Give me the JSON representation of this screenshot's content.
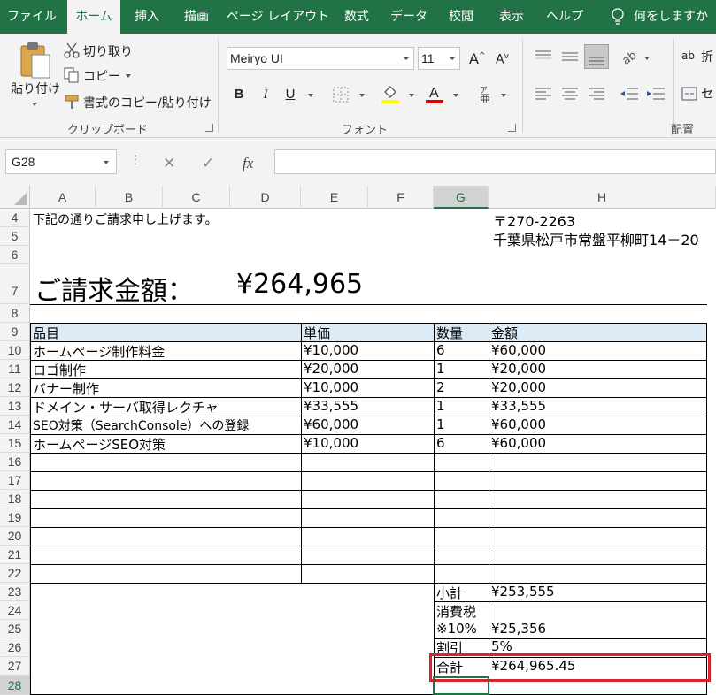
{
  "menu": {
    "tabs": [
      "ファイル",
      "ホーム",
      "挿入",
      "描画",
      "ページ レイアウト",
      "数式",
      "データ",
      "校閲",
      "表示",
      "ヘルプ"
    ],
    "tell_me": "何をしますか"
  },
  "ribbon": {
    "clipboard": {
      "paste": "貼り付け",
      "cut": "切り取り",
      "copy": "コピー",
      "format_painter": "書式のコピー/貼り付け",
      "label": "クリップボード"
    },
    "font": {
      "font_name": "Meiryo UI",
      "font_size": "11",
      "bold": "B",
      "italic": "I",
      "underline": "U",
      "label": "フォント"
    },
    "alignment": {
      "wrap": "折",
      "merge": "セ",
      "label": "配置"
    }
  },
  "formula_bar": {
    "name_box": "G28",
    "fx": "fx",
    "formula": ""
  },
  "sheet": {
    "columns": [
      "A",
      "B",
      "C",
      "D",
      "E",
      "F",
      "G",
      "H"
    ],
    "rows": [
      "4",
      "5",
      "6",
      "7",
      "8",
      "9",
      "10",
      "11",
      "12",
      "13",
      "14",
      "15",
      "16",
      "17",
      "18",
      "19",
      "20",
      "21",
      "22",
      "23",
      "24",
      "25",
      "26",
      "27",
      "28"
    ],
    "intro": "下記の通りご請求申し上げます。",
    "postal": "〒270-2263",
    "address": "千葉県松戸市常盤平柳町14－20",
    "total_label": "ご請求金額：",
    "total_value": "¥264,965",
    "table_header": [
      "品目",
      "単価",
      "数量",
      "金額"
    ],
    "items": [
      {
        "name": "ホームページ制作料金",
        "price": "¥10,000",
        "qty": "6",
        "amount": "¥60,000"
      },
      {
        "name": "ロゴ制作",
        "price": "¥20,000",
        "qty": "1",
        "amount": "¥20,000"
      },
      {
        "name": "バナー制作",
        "price": "¥10,000",
        "qty": "2",
        "amount": "¥20,000"
      },
      {
        "name": "ドメイン・サーバ取得レクチャ",
        "price": "¥33,555",
        "qty": "1",
        "amount": "¥33,555"
      },
      {
        "name": "SEO対策（SearchConsole）への登録",
        "price": "¥60,000",
        "qty": "1",
        "amount": "¥60,000"
      },
      {
        "name": "ホームページSEO対策",
        "price": "¥10,000",
        "qty": "6",
        "amount": "¥60,000"
      }
    ],
    "subtotal_label": "小計",
    "subtotal_value": "¥253,555",
    "tax_label_1": "消費税",
    "tax_label_2": "※10%",
    "tax_value": "¥25,356",
    "discount_label": "割引",
    "discount_value": "5%",
    "grand_label": "合計",
    "grand_value": "¥264,965.45"
  },
  "colors": {
    "excel_green": "#217346",
    "header_fill": "#ddebf7",
    "highlight_red": "#d9242b"
  }
}
